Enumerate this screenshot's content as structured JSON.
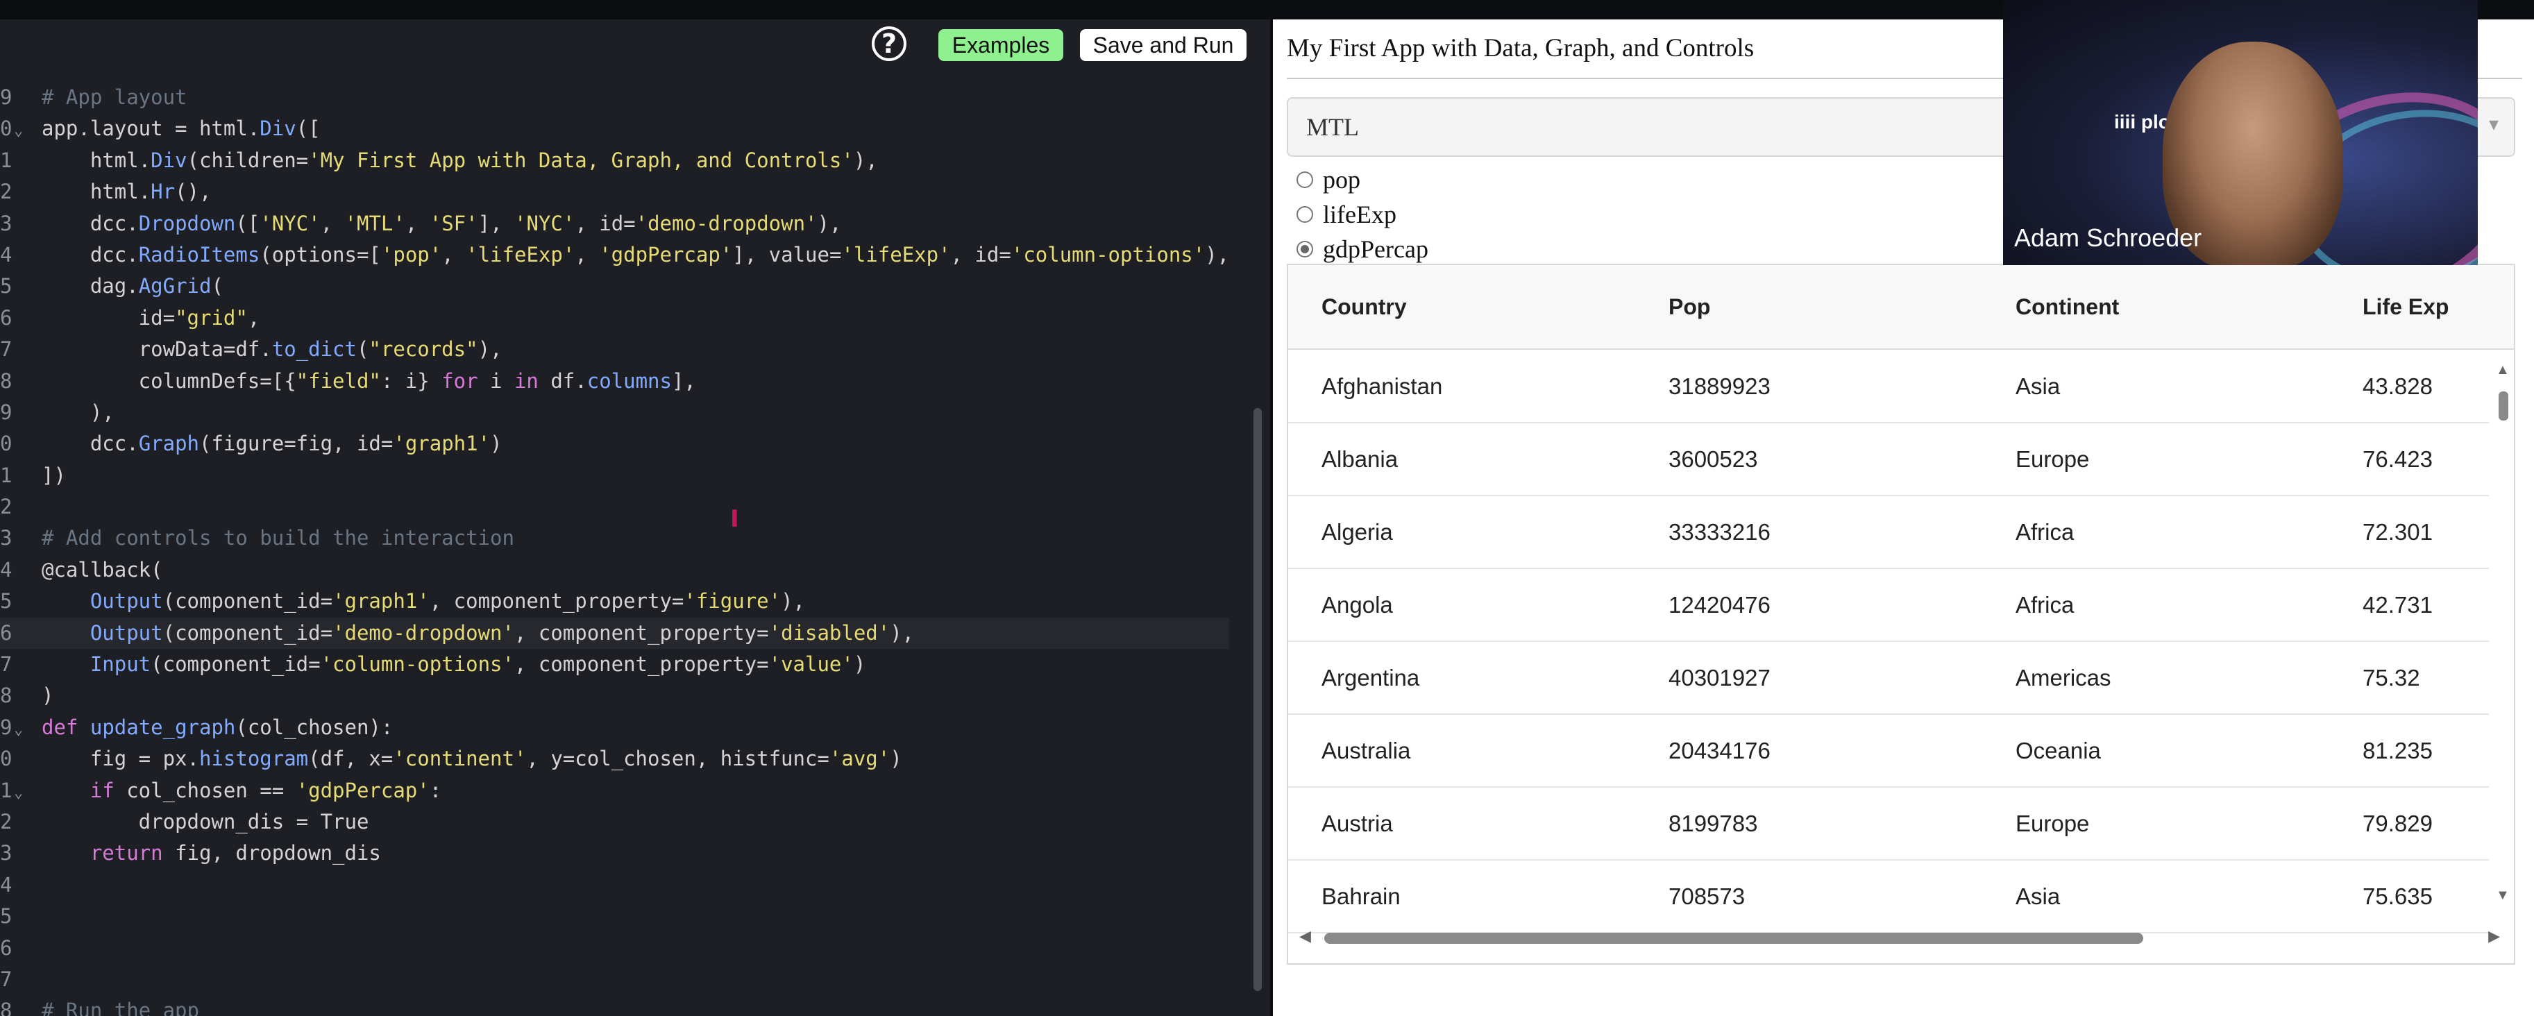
{
  "editor": {
    "help_label": "?",
    "examples_label": "Examples",
    "save_run_label": "Save and Run",
    "lines": [
      {
        "n": "9",
        "fold": "",
        "html": "<span class=\"cm\"># App layout</span>"
      },
      {
        "n": "0",
        "fold": "⌄",
        "html": "app.layout = html.<span class=\"fn\">Div</span>(["
      },
      {
        "n": "1",
        "fold": "",
        "html": "    html.<span class=\"fn\">Div</span>(children=<span class=\"str\">'My First App with Data, Graph, and Controls'</span>),"
      },
      {
        "n": "2",
        "fold": "",
        "html": "    html.<span class=\"fn\">Hr</span>(),"
      },
      {
        "n": "3",
        "fold": "",
        "html": "    dcc.<span class=\"fn\">Dropdown</span>([<span class=\"str\">'NYC'</span>, <span class=\"str\">'MTL'</span>, <span class=\"str\">'SF'</span>], <span class=\"str\">'NYC'</span>, id=<span class=\"str\">'demo-dropdown'</span>),"
      },
      {
        "n": "4",
        "fold": "",
        "html": "    dcc.<span class=\"fn\">RadioItems</span>(options=[<span class=\"str\">'pop'</span>, <span class=\"str\">'lifeExp'</span>, <span class=\"str\">'gdpPercap'</span>], value=<span class=\"str\">'lifeExp'</span>, id=<span class=\"str\">'column-options'</span>),"
      },
      {
        "n": "5",
        "fold": "",
        "html": "    dag.<span class=\"fn\">AgGrid</span>("
      },
      {
        "n": "6",
        "fold": "",
        "html": "        id=<span class=\"str\">\"grid\"</span>,"
      },
      {
        "n": "7",
        "fold": "",
        "html": "        rowData=df.<span class=\"fn\">to_dict</span>(<span class=\"str\">\"records\"</span>),"
      },
      {
        "n": "8",
        "fold": "",
        "html": "        columnDefs=[{<span class=\"str\">\"field\"</span>: i} <span class=\"kw\">for</span> i <span class=\"kw\">in</span> df.<span class=\"fn\">columns</span>],"
      },
      {
        "n": "9",
        "fold": "",
        "html": "    ),"
      },
      {
        "n": "0",
        "fold": "",
        "html": "    dcc.<span class=\"fn\">Graph</span>(figure=fig, id=<span class=\"str\">'graph1'</span>)"
      },
      {
        "n": "1",
        "fold": "",
        "html": "])"
      },
      {
        "n": "2",
        "fold": "",
        "html": ""
      },
      {
        "n": "3",
        "fold": "",
        "html": "<span class=\"cm\"># Add controls to build the interaction</span>"
      },
      {
        "n": "4",
        "fold": "",
        "html": "@callback("
      },
      {
        "n": "5",
        "fold": "",
        "html": "    <span class=\"fn\">Output</span>(component_id=<span class=\"str\">'graph1'</span>, component_property=<span class=\"str\">'figure'</span>),"
      },
      {
        "n": "6",
        "fold": "",
        "html": "    <span class=\"fn\">Output</span>(component_id=<span class=\"str\">'demo-dropdown'</span>, component_property=<span class=\"str\">'disabled'</span>),",
        "highlight": true
      },
      {
        "n": "7",
        "fold": "",
        "html": "    <span class=\"fn\">Input</span>(component_id=<span class=\"str\">'column-options'</span>, component_property=<span class=\"str\">'value'</span>)"
      },
      {
        "n": "8",
        "fold": "",
        "html": ")"
      },
      {
        "n": "9",
        "fold": "⌄",
        "html": "<span class=\"kw\">def</span> <span class=\"fn\">update_graph</span>(col_chosen):"
      },
      {
        "n": "0",
        "fold": "",
        "html": "    fig = px.<span class=\"fn\">histogram</span>(df, x=<span class=\"str\">'continent'</span>, y=col_chosen, histfunc=<span class=\"str\">'avg'</span>)"
      },
      {
        "n": "1",
        "fold": "⌄",
        "html": "    <span class=\"kw\">if</span> col_chosen == <span class=\"str\">'gdpPercap'</span>:"
      },
      {
        "n": "2",
        "fold": "",
        "html": "        dropdown_dis = True"
      },
      {
        "n": "3",
        "fold": "",
        "html": "    <span class=\"kw\">return</span> fig, dropdown_dis"
      },
      {
        "n": "4",
        "fold": "",
        "html": ""
      },
      {
        "n": "5",
        "fold": "",
        "html": ""
      },
      {
        "n": "6",
        "fold": "",
        "html": ""
      },
      {
        "n": "7",
        "fold": "",
        "html": ""
      },
      {
        "n": "8",
        "fold": "",
        "html": "<span class=\"cm\"># Run the app</span>"
      }
    ]
  },
  "app": {
    "title": "My First App with Data, Graph, and Controls",
    "dropdown_value": "MTL",
    "dropdown_arrow": "▾",
    "radio_options": [
      {
        "label": "pop",
        "checked": false
      },
      {
        "label": "lifeExp",
        "checked": false
      },
      {
        "label": "gdpPercap",
        "checked": true
      }
    ],
    "grid": {
      "columns": [
        "Country",
        "Pop",
        "Continent",
        "Life Exp"
      ],
      "rows": [
        [
          "Afghanistan",
          "31889923",
          "Asia",
          "43.828"
        ],
        [
          "Albania",
          "3600523",
          "Europe",
          "76.423"
        ],
        [
          "Algeria",
          "33333216",
          "Africa",
          "72.301"
        ],
        [
          "Angola",
          "12420476",
          "Africa",
          "42.731"
        ],
        [
          "Argentina",
          "40301927",
          "Americas",
          "75.32"
        ],
        [
          "Australia",
          "20434176",
          "Oceania",
          "81.235"
        ],
        [
          "Austria",
          "8199783",
          "Europe",
          "79.829"
        ],
        [
          "Bahrain",
          "708573",
          "Asia",
          "75.635"
        ]
      ],
      "scroll_up": "▲",
      "scroll_down": "▼",
      "scroll_left": "◀",
      "scroll_right": "▶"
    }
  },
  "webcam": {
    "logo": "iiii plotly",
    "name": "Adam Schroeder"
  }
}
